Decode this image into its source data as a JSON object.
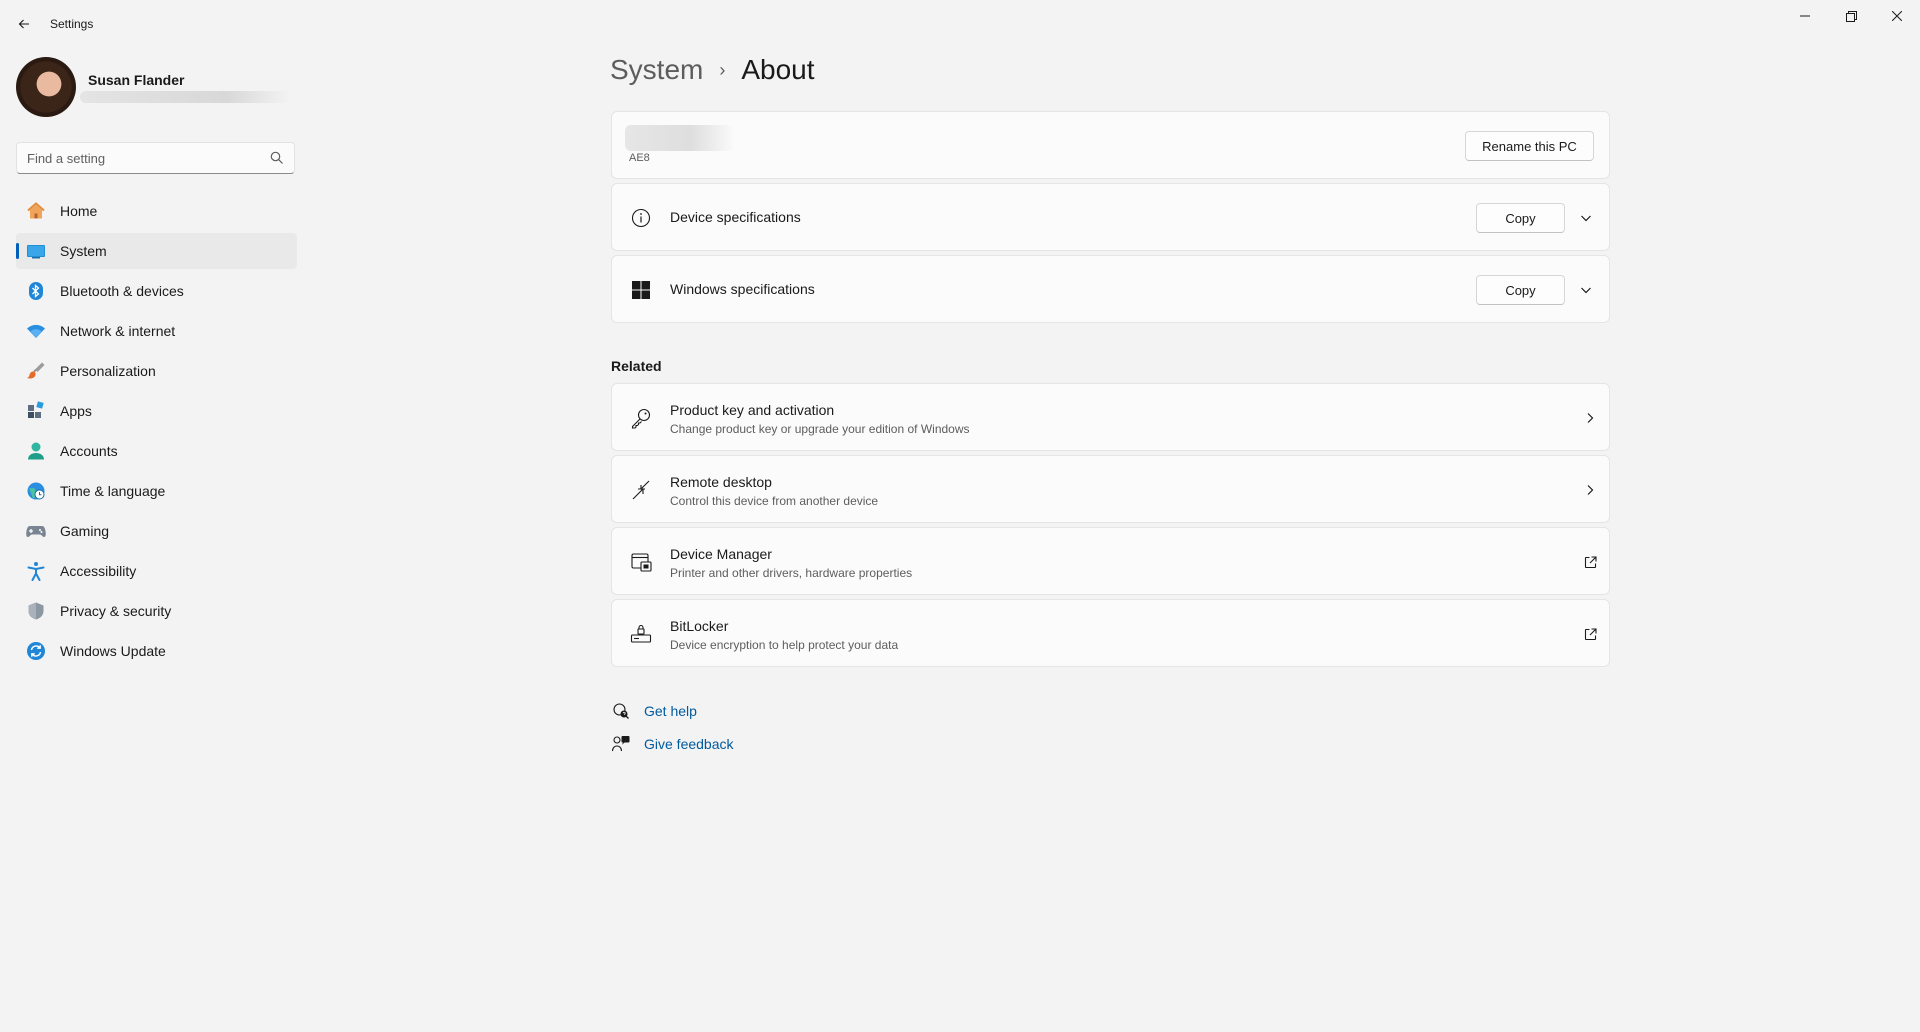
{
  "window": {
    "title": "Settings"
  },
  "profile": {
    "name": "Susan Flander"
  },
  "search": {
    "placeholder": "Find a setting"
  },
  "sidebar": {
    "items": [
      {
        "label": "Home",
        "icon": "home-icon"
      },
      {
        "label": "System",
        "icon": "system-icon",
        "active": true
      },
      {
        "label": "Bluetooth & devices",
        "icon": "bluetooth-icon"
      },
      {
        "label": "Network & internet",
        "icon": "wifi-icon"
      },
      {
        "label": "Personalization",
        "icon": "brush-icon"
      },
      {
        "label": "Apps",
        "icon": "apps-icon"
      },
      {
        "label": "Accounts",
        "icon": "accounts-icon"
      },
      {
        "label": "Time & language",
        "icon": "globe-clock-icon"
      },
      {
        "label": "Gaming",
        "icon": "gamepad-icon"
      },
      {
        "label": "Accessibility",
        "icon": "accessibility-icon"
      },
      {
        "label": "Privacy & security",
        "icon": "shield-icon"
      },
      {
        "label": "Windows Update",
        "icon": "sync-icon"
      }
    ]
  },
  "breadcrumb": {
    "parent": "System",
    "separator": "›",
    "current": "About"
  },
  "pc_card": {
    "model": "AE8",
    "rename_label": "Rename this PC"
  },
  "specs": [
    {
      "title": "Device specifications",
      "copy_label": "Copy",
      "icon": "info-icon"
    },
    {
      "title": "Windows specifications",
      "copy_label": "Copy",
      "icon": "windows-logo-icon"
    }
  ],
  "related": {
    "heading": "Related",
    "items": [
      {
        "title": "Product key and activation",
        "desc": "Change product key or upgrade your edition of Windows",
        "icon": "key-icon",
        "end": "chevron-right-icon"
      },
      {
        "title": "Remote desktop",
        "desc": "Control this device from another device",
        "icon": "remote-desktop-icon",
        "end": "chevron-right-icon"
      },
      {
        "title": "Device Manager",
        "desc": "Printer and other drivers, hardware properties",
        "icon": "device-manager-icon",
        "end": "external-link-icon"
      },
      {
        "title": "BitLocker",
        "desc": "Device encryption to help protect your data",
        "icon": "bitlocker-icon",
        "end": "external-link-icon"
      }
    ]
  },
  "help": {
    "get_help": "Get help",
    "give_feedback": "Give feedback"
  },
  "colors": {
    "accent": "#005fb8",
    "link": "#005a9e",
    "background": "#f3f3f3",
    "card": "#fbfbfb"
  }
}
